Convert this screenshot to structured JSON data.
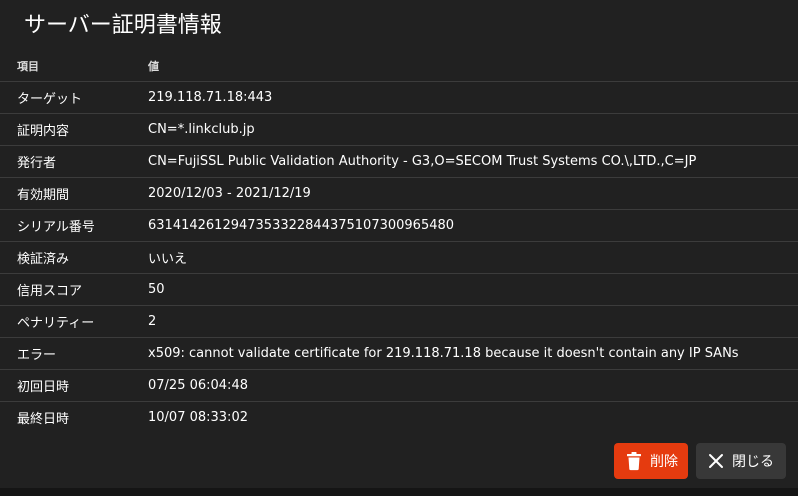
{
  "dialog": {
    "title": "サーバー証明書情報"
  },
  "table": {
    "headers": {
      "item": "項目",
      "value": "値"
    },
    "rows": [
      {
        "label": "ターゲット",
        "value": "219.118.71.18:443"
      },
      {
        "label": "証明内容",
        "value": "CN=*.linkclub.jp"
      },
      {
        "label": "発行者",
        "value": "CN=FujiSSL Public Validation Authority - G3,O=SECOM Trust Systems CO.\\,LTD.,C=JP"
      },
      {
        "label": "有効期間",
        "value": "2020/12/03 - 2021/12/19"
      },
      {
        "label": "シリアル番号",
        "value": "63141426129473533228443751073009654​80"
      },
      {
        "label": "検証済み",
        "value": "いいえ"
      },
      {
        "label": "信用スコア",
        "value": "50"
      },
      {
        "label": "ペナリティー",
        "value": "2"
      },
      {
        "label": "エラー",
        "value": "x509: cannot validate certificate for 219.118.71.18 because it doesn't contain any IP SANs"
      },
      {
        "label": "初回日時",
        "value": "07/25 06:04:48"
      },
      {
        "label": "最終日時",
        "value": "10/07 08:33:02"
      }
    ]
  },
  "actions": {
    "delete_label": "削除",
    "close_label": "閉じる",
    "delete_icon": "trash-icon",
    "close_icon": "close-icon",
    "delete_color": "#e53b0f"
  }
}
